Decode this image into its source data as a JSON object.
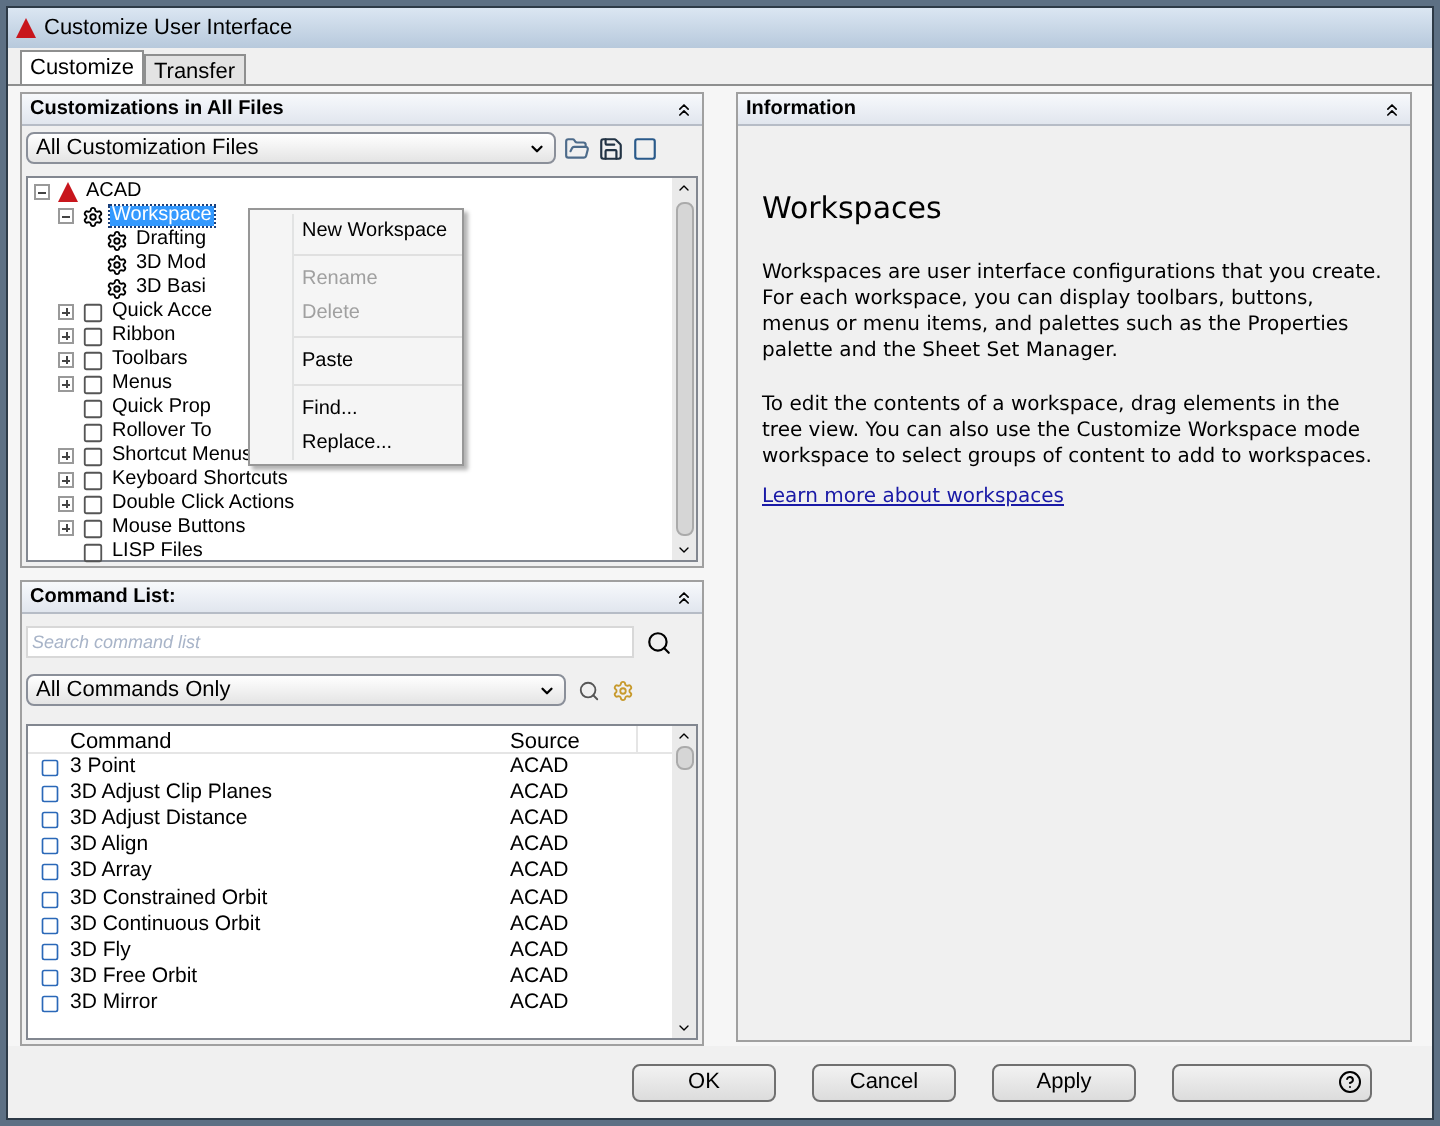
{
  "window": {
    "title": "Customize User Interface"
  },
  "tabs": [
    {
      "label": "Customize",
      "selected": true
    },
    {
      "label": "Transfer",
      "selected": false
    }
  ],
  "customizations": {
    "title": "Customizations in All Files",
    "filter": "All Customization Files",
    "tree": [
      {
        "label": "ACAD",
        "expanded": true,
        "selected": false,
        "children": [
          {
            "label": "Workspace",
            "expanded": true,
            "selected": true,
            "children": [
              {
                "label": "Drafting",
                "selected": false
              },
              {
                "label": "3D Mod",
                "selected": false
              },
              {
                "label": "3D Basi",
                "selected": false
              }
            ]
          },
          {
            "label": "Quick Acce",
            "expanded": false,
            "selected": false
          },
          {
            "label": "Ribbon",
            "expanded": false,
            "selected": false
          },
          {
            "label": "Toolbars",
            "expanded": false,
            "selected": false
          },
          {
            "label": "Menus",
            "expanded": false,
            "selected": false
          },
          {
            "label": "Quick Prop",
            "selected": false
          },
          {
            "label": "Rollover To",
            "selected": false
          },
          {
            "label": "Shortcut Menus",
            "expanded": false,
            "selected": false
          },
          {
            "label": "Keyboard Shortcuts",
            "expanded": false,
            "selected": false
          },
          {
            "label": "Double Click Actions",
            "expanded": false,
            "selected": false
          },
          {
            "label": "Mouse Buttons",
            "expanded": false,
            "selected": false
          },
          {
            "label": "LISP Files",
            "selected": false
          }
        ]
      }
    ]
  },
  "context_menu": [
    {
      "kind": "item",
      "label": "New Workspace",
      "disabled": false
    },
    {
      "kind": "separator"
    },
    {
      "kind": "item",
      "label": "Rename",
      "disabled": true
    },
    {
      "kind": "item",
      "label": "Delete",
      "disabled": true
    },
    {
      "kind": "separator"
    },
    {
      "kind": "item",
      "label": "Paste",
      "disabled": false
    },
    {
      "kind": "separator"
    },
    {
      "kind": "item",
      "label": "Find...",
      "disabled": false
    },
    {
      "kind": "item",
      "label": "Replace...",
      "disabled": false
    }
  ],
  "command_list": {
    "title": "Command List:",
    "search": {
      "placeholder": "Search command list"
    },
    "filter": "All Commands Only",
    "columns": [
      "Command",
      "Source"
    ],
    "rows": [
      {
        "command": "3 Point",
        "source": "ACAD"
      },
      {
        "command": "3D Adjust Clip Planes",
        "source": "ACAD"
      },
      {
        "command": "3D Adjust Distance",
        "source": "ACAD"
      },
      {
        "command": "3D Align",
        "source": "ACAD"
      },
      {
        "command": "3D Array",
        "source": "ACAD"
      },
      {
        "command": "3D Constrained Orbit",
        "source": "ACAD"
      },
      {
        "command": "3D Continuous Orbit",
        "source": "ACAD"
      },
      {
        "command": "3D Fly",
        "source": "ACAD"
      },
      {
        "command": "3D Free Orbit",
        "source": "ACAD"
      },
      {
        "command": "3D Mirror",
        "source": "ACAD"
      }
    ]
  },
  "information": {
    "title": "Information",
    "heading": "Workspaces",
    "paragraphs": [
      "Workspaces are user interface configurations that you create. For each workspace, you can display toolbars, buttons, menus or menu items, and palettes such as the Properties palette and the Sheet Set Manager.",
      "To edit the contents of a workspace, drag elements in the tree view. You can also use the Customize Workspace mode workspace to select groups of content to add to workspaces."
    ],
    "link": "Learn more about workspaces"
  },
  "buttons": [
    "OK",
    "Cancel",
    "Apply"
  ]
}
